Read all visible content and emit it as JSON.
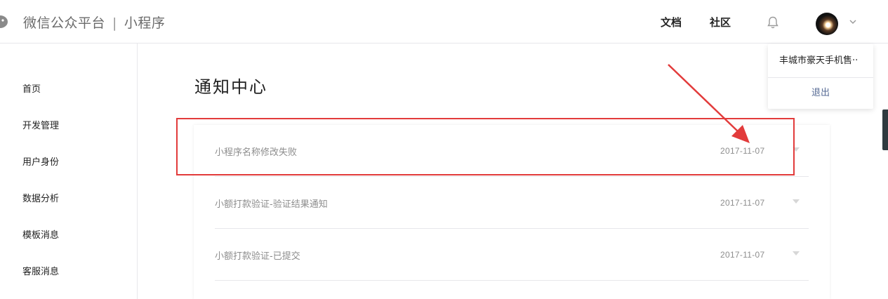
{
  "header": {
    "brand_main": "微信公众平台",
    "brand_sep": "|",
    "brand_sub": "小程序",
    "nav": [
      "文档",
      "社区"
    ]
  },
  "icons": {
    "logo": "wechat-logo-icon",
    "bell": "bell-icon",
    "chevron": "chevron-down-icon",
    "row_arrow": "caret-down-icon"
  },
  "dropdown": {
    "account_name": "丰城市豪天手机售··",
    "logout": "退出"
  },
  "sidebar": {
    "items": [
      "首页",
      "开发管理",
      "用户身份",
      "数据分析",
      "模板消息",
      "客服消息"
    ]
  },
  "main": {
    "title": "通知中心",
    "notifications": [
      {
        "title": "小程序名称修改失败",
        "date": "2017-11-07"
      },
      {
        "title": "小额打款验证-验证结果通知",
        "date": "2017-11-07"
      },
      {
        "title": "小额打款验证-已提交",
        "date": "2017-11-07"
      }
    ]
  },
  "colors": {
    "annotation_red": "#e23b3b",
    "link_blue": "#576b95"
  }
}
